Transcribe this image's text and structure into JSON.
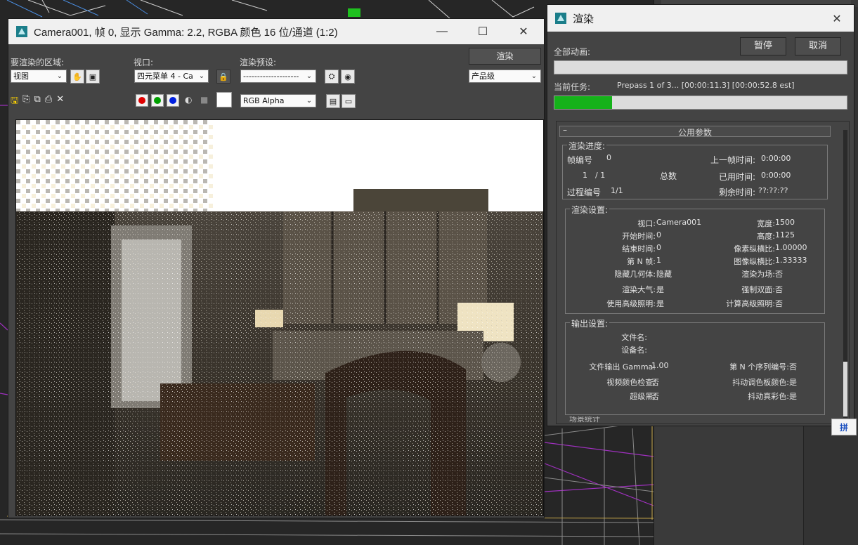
{
  "framebuffer": {
    "title": "Camera001, 帧 0, 显示 Gamma: 2.2, RGBA 颜色 16 位/通道 (1:2)",
    "area_label": "要渲染的区域:",
    "area_value": "视图",
    "viewport_label": "视口:",
    "viewport_value": "四元菜单 4 - Ca",
    "preset_label": "渲染预设:",
    "preset_value": "--------------------",
    "render_button": "渲染",
    "quality_value": "产品级",
    "channel_value": "RGB Alpha"
  },
  "render_dialog": {
    "title": "渲染",
    "pause_button": "暂停",
    "cancel_button": "取消",
    "all_anim_label": "全部动画:",
    "all_anim_progress": 0,
    "current_task_label": "当前任务:",
    "current_task_text": "Prepass 1 of 3... [00:00:11.3] [00:00:52.8 est]",
    "current_task_progress": 0.196,
    "rollout_title": "公用参数",
    "rollout_toggle": "–",
    "progress_group": {
      "title": "渲染进度:",
      "frame_label": "帧编号",
      "frame_value": "0",
      "last_frame_time_label": "上一帧时间:",
      "last_frame_time_value": "0:00:00",
      "count_value": "1",
      "count_total": "/ 1",
      "total_label": "总数",
      "elapsed_label": "已用时间:",
      "elapsed_value": "0:00:00",
      "pass_label": "过程编号",
      "pass_value": "1/1",
      "remaining_label": "剩余时间:",
      "remaining_value": "??:??:??"
    },
    "settings_group": {
      "title": "渲染设置:",
      "left": [
        {
          "label": "视口:",
          "value": "Camera001"
        },
        {
          "label": "开始时间:",
          "value": "0"
        },
        {
          "label": "结束时间:",
          "value": "0"
        },
        {
          "label": "第 N 帧:",
          "value": "1"
        },
        {
          "label": "隐藏几何体:",
          "value": "隐藏"
        },
        {
          "label": "渲染大气:",
          "value": "是"
        },
        {
          "label": "使用高级照明:",
          "value": "是"
        }
      ],
      "right": [
        {
          "label": "宽度:",
          "value": "1500"
        },
        {
          "label": "高度:",
          "value": "1125"
        },
        {
          "label": "像素纵横比:",
          "value": "1.00000"
        },
        {
          "label": "图像纵横比:",
          "value": "1.33333"
        },
        {
          "label": "渲染为场:",
          "value": "否"
        },
        {
          "label": "强制双面:",
          "value": "否"
        },
        {
          "label": "计算高级照明:",
          "value": "否"
        }
      ]
    },
    "output_group": {
      "title": "输出设置:",
      "filename_label": "文件名:",
      "device_label": "设备名:",
      "left": [
        {
          "label": "文件输出 Gamma:",
          "value": "1.00"
        },
        {
          "label": "视频颜色检查:",
          "value": "否"
        },
        {
          "label": "超级黑:",
          "value": "否"
        }
      ],
      "right": [
        {
          "label": "第 N 个序列编号:",
          "value": "否"
        },
        {
          "label": "抖动调色板颜色:",
          "value": "是"
        },
        {
          "label": "抖动真彩色:",
          "value": "是"
        }
      ]
    },
    "cut_label": "场景统计"
  },
  "ime_badge": "拼"
}
